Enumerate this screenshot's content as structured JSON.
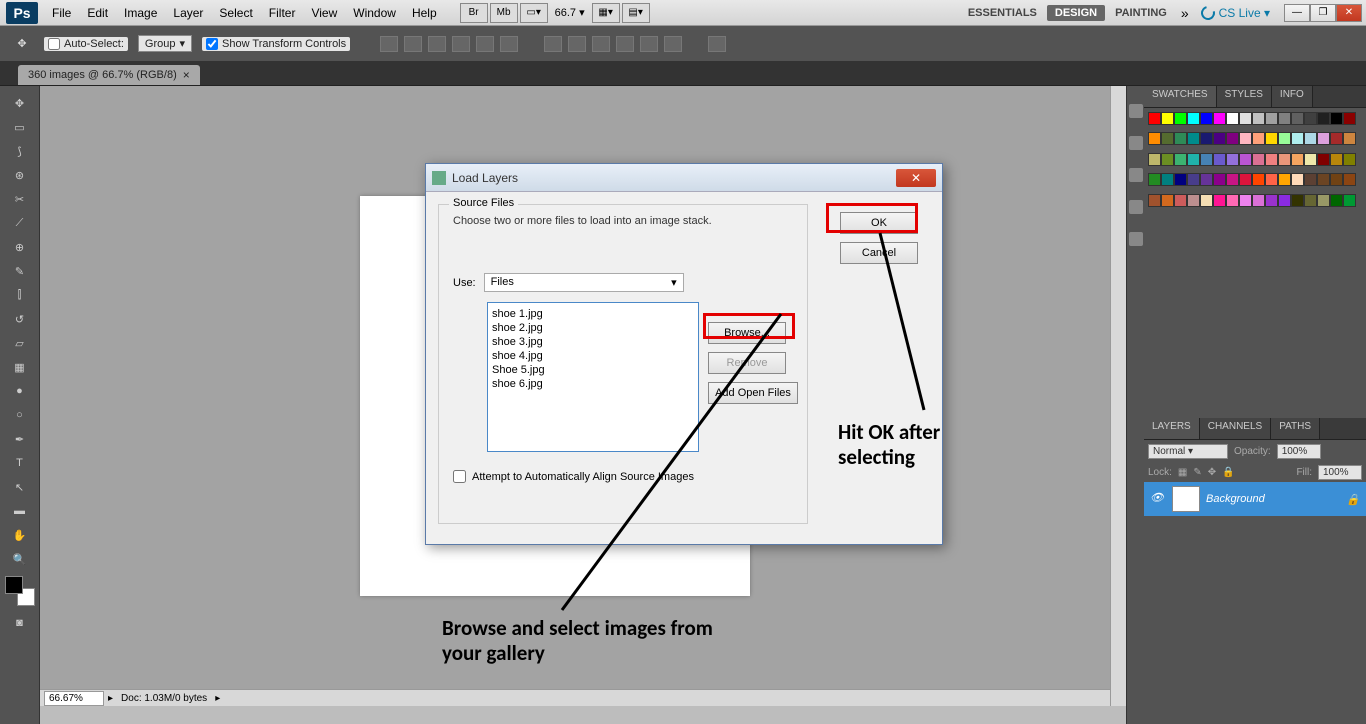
{
  "menubar": {
    "items": [
      "File",
      "Edit",
      "Image",
      "Layer",
      "Select",
      "Filter",
      "View",
      "Window",
      "Help"
    ],
    "zoom": "66.7 ▾",
    "workspaces": [
      "ESSENTIALS",
      "DESIGN",
      "PAINTING"
    ],
    "cslive": "CS Live ▾"
  },
  "optionsbar": {
    "autoselect": "Auto-Select:",
    "group": "Group",
    "showtransform": "Show Transform Controls"
  },
  "tab": {
    "title": "360 images @ 66.7% (RGB/8)",
    "close": "×"
  },
  "statusbar": {
    "zoom": "66.67%",
    "doc": "Doc: 1.03M/0 bytes"
  },
  "panels": {
    "swatches_tabs": [
      "SWATCHES",
      "STYLES",
      "INFO"
    ],
    "layers_tabs": [
      "LAYERS",
      "CHANNELS",
      "PATHS"
    ],
    "blend": "Normal",
    "opacity_lbl": "Opacity:",
    "opacity": "100%",
    "lock_lbl": "Lock:",
    "fill_lbl": "Fill:",
    "fill": "100%",
    "bg_layer": "Background"
  },
  "dialog": {
    "title": "Load Layers",
    "fieldset": "Source Files",
    "desc": "Choose two or more files to load into an image stack.",
    "use_lbl": "Use:",
    "use_val": "Files",
    "files": [
      "shoe 1.jpg",
      "shoe 2.jpg",
      "shoe 3.jpg",
      "shoe 4.jpg",
      "Shoe 5.jpg",
      "shoe 6.jpg"
    ],
    "ok": "OK",
    "cancel": "Cancel",
    "browse": "Browse...",
    "remove": "Remove",
    "addopen": "Add Open Files",
    "attempt": "Attempt to Automatically Align Source Images"
  },
  "annot": {
    "a1": "Hit OK after selecting",
    "a2": "Browse and select images from your gallery"
  },
  "swatch_colors": [
    "#ff0000",
    "#ffff00",
    "#00ff00",
    "#00ffff",
    "#0000ff",
    "#ff00ff",
    "#ffffff",
    "#e0e0e0",
    "#c0c0c0",
    "#a0a0a0",
    "#808080",
    "#606060",
    "#404040",
    "#202020",
    "#000000",
    "#8b0000",
    "#ff8c00",
    "#556b2f",
    "#2e8b57",
    "#008b8b",
    "#191970",
    "#4b0082",
    "#800080",
    "#ffb6c1",
    "#ffa07a",
    "#ffd700",
    "#98fb98",
    "#afeeee",
    "#add8e6",
    "#dda0dd",
    "#a52a2a",
    "#cd853f",
    "#bdb76b",
    "#6b8e23",
    "#3cb371",
    "#20b2aa",
    "#4682b4",
    "#6a5acd",
    "#9370db",
    "#ba55d3",
    "#db7093",
    "#f08080",
    "#e9967a",
    "#f4a460",
    "#eee8aa",
    "#800000",
    "#b8860b",
    "#808000",
    "#228b22",
    "#008080",
    "#000080",
    "#483d8b",
    "#663399",
    "#8b008b",
    "#c71585",
    "#dc143c",
    "#ff4500",
    "#ff6347",
    "#ffa500",
    "#ffdab9",
    "#5c4033",
    "#6b4423",
    "#704214",
    "#8b4513",
    "#a0522d",
    "#d2691e",
    "#cd5c5c",
    "#bc8f8f",
    "#f5deb3",
    "#ff1493",
    "#ff69b4",
    "#ee82ee",
    "#da70d6",
    "#9932cc",
    "#8a2be2",
    "#333300",
    "#666633",
    "#999966",
    "#006600",
    "#009933"
  ]
}
